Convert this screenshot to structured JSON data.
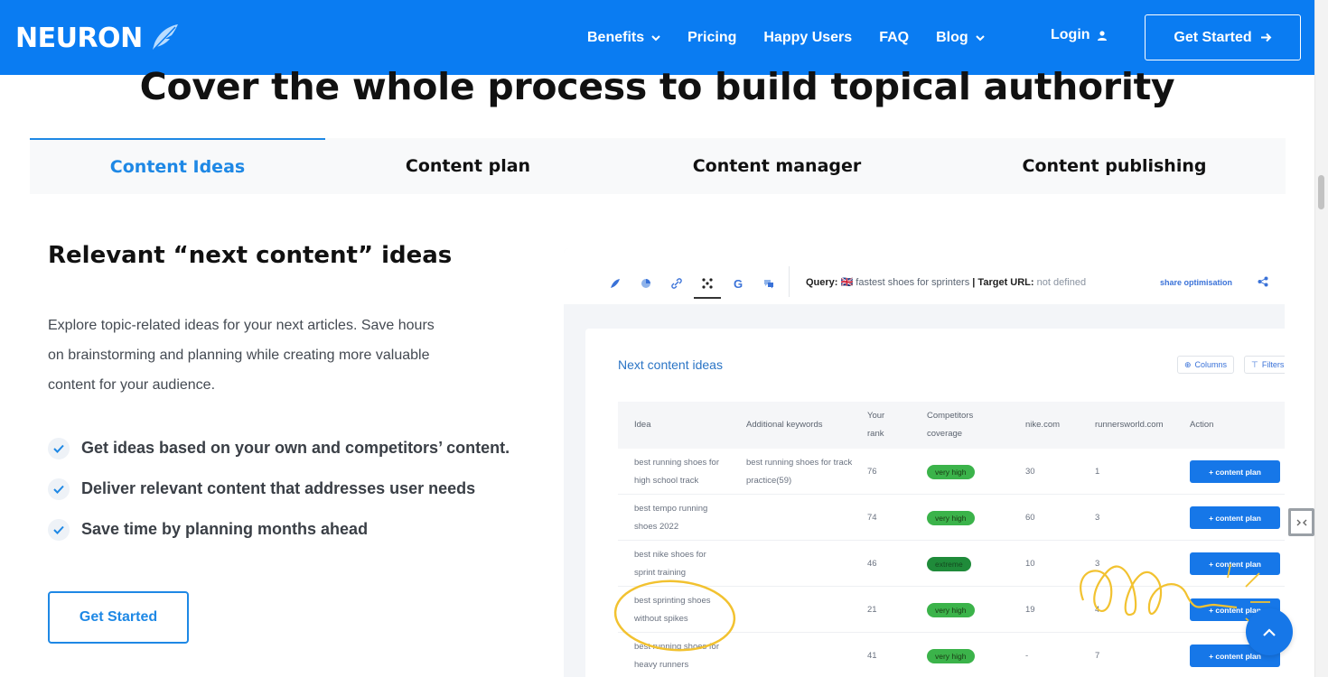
{
  "nav": {
    "logo": "NEURON",
    "links": [
      {
        "label": "Benefits",
        "dropdown": true
      },
      {
        "label": "Pricing",
        "dropdown": false
      },
      {
        "label": "Happy Users",
        "dropdown": false
      },
      {
        "label": "FAQ",
        "dropdown": false
      },
      {
        "label": "Blog",
        "dropdown": true
      }
    ],
    "login": "Login",
    "cta": "Get Started"
  },
  "heading": "Cover the whole process to build topical authority",
  "tabs": [
    {
      "label": "Content Ideas",
      "active": true
    },
    {
      "label": "Content plan",
      "active": false
    },
    {
      "label": "Content manager",
      "active": false
    },
    {
      "label": "Content publishing",
      "active": false
    }
  ],
  "section": {
    "title": "Relevant “next content” ideas",
    "description": "Explore topic-related ideas for your next articles. Save hours on brainstorming and planning while creating more valuable content for your audience.",
    "features": [
      "Get ideas based on your own and competitors’ content.",
      "Deliver relevant content that addresses user needs",
      "Save time by planning months ahead"
    ],
    "cta": "Get Started"
  },
  "app": {
    "query_label": "Query:",
    "query_value": "🇬🇧 fastest shoes for sprinters",
    "target_label": "| Target URL:",
    "target_value": "not defined",
    "share": "share optimisation",
    "card_title": "Next content ideas",
    "chip_columns": "Columns",
    "chip_filters": "Filters",
    "headers": {
      "idea": "Idea",
      "keywords": "Additional keywords",
      "rank": "Your rank",
      "coverage": "Competitors coverage",
      "nike": "nike.com",
      "rw": "runnersworld.com",
      "action": "Action"
    },
    "rows": [
      {
        "idea": "best running shoes for high school track",
        "keywords": "best running shoes for track practice(59)",
        "rank": "76",
        "coverage": "very high",
        "nike": "30",
        "rw": "1",
        "action": "+ content plan"
      },
      {
        "idea": "best tempo running shoes 2022",
        "keywords": "",
        "rank": "74",
        "coverage": "very high",
        "nike": "60",
        "rw": "3",
        "action": "+ content plan"
      },
      {
        "idea": "best nike shoes for sprint training",
        "keywords": "",
        "rank": "46",
        "coverage": "extreme",
        "nike": "10",
        "rw": "3",
        "action": "+ content plan"
      },
      {
        "idea": "best sprinting shoes without spikes",
        "keywords": "",
        "rank": "21",
        "coverage": "very high",
        "nike": "19",
        "rw": "4",
        "action": "+ content plan"
      },
      {
        "idea": "best running shoes for heavy runners",
        "keywords": "",
        "rank": "41",
        "coverage": "very high",
        "nike": "-",
        "rw": "7",
        "action": "+ content plan"
      }
    ]
  },
  "colors": {
    "brand": "#0a7cf2",
    "accent": "#1e88e5",
    "badge": "#3bb34a"
  }
}
